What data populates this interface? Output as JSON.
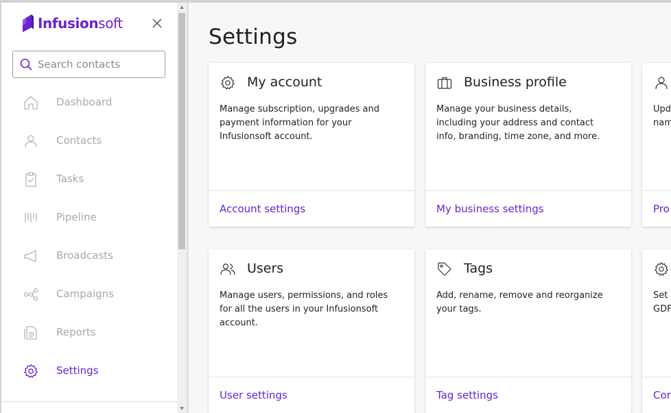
{
  "brand": {
    "name_bold": "Infusion",
    "name_light": "soft",
    "color": "#6a22cf"
  },
  "search": {
    "placeholder": "Search contacts",
    "value": ""
  },
  "sidebar": {
    "items": [
      {
        "label": "Dashboard",
        "icon": "home-icon"
      },
      {
        "label": "Contacts",
        "icon": "person-icon"
      },
      {
        "label": "Tasks",
        "icon": "clipboard-check-icon"
      },
      {
        "label": "Pipeline",
        "icon": "pipeline-icon"
      },
      {
        "label": "Broadcasts",
        "icon": "megaphone-icon"
      },
      {
        "label": "Campaigns",
        "icon": "campaigns-icon"
      },
      {
        "label": "Reports",
        "icon": "report-icon"
      },
      {
        "label": "Settings",
        "icon": "gear-icon",
        "active": true
      }
    ]
  },
  "main": {
    "title": "Settings",
    "cards": [
      {
        "title": "My account",
        "icon": "gear-icon",
        "description": "Manage subscription, upgrades and payment information for your Infusionsoft account.",
        "link": "Account settings"
      },
      {
        "title": "Business profile",
        "icon": "briefcase-icon",
        "description": "Manage your business details, including your address and contact info, branding, time zone, and more.",
        "link": "My business settings"
      },
      {
        "title": "",
        "icon": "person-icon",
        "description": "Upd\nnam",
        "link": "Pro"
      },
      {
        "title": "Users",
        "icon": "users-icon",
        "description": "Manage users, permissions, and roles for all the users in your Infusionsoft account.",
        "link": "User settings"
      },
      {
        "title": "Tags",
        "icon": "tag-icon",
        "description": "Add, rename, remove and reorganize your tags.",
        "link": "Tag settings"
      },
      {
        "title": "",
        "icon": "gear-icon",
        "description": "Set\nGDF",
        "link": "Cor"
      }
    ]
  }
}
